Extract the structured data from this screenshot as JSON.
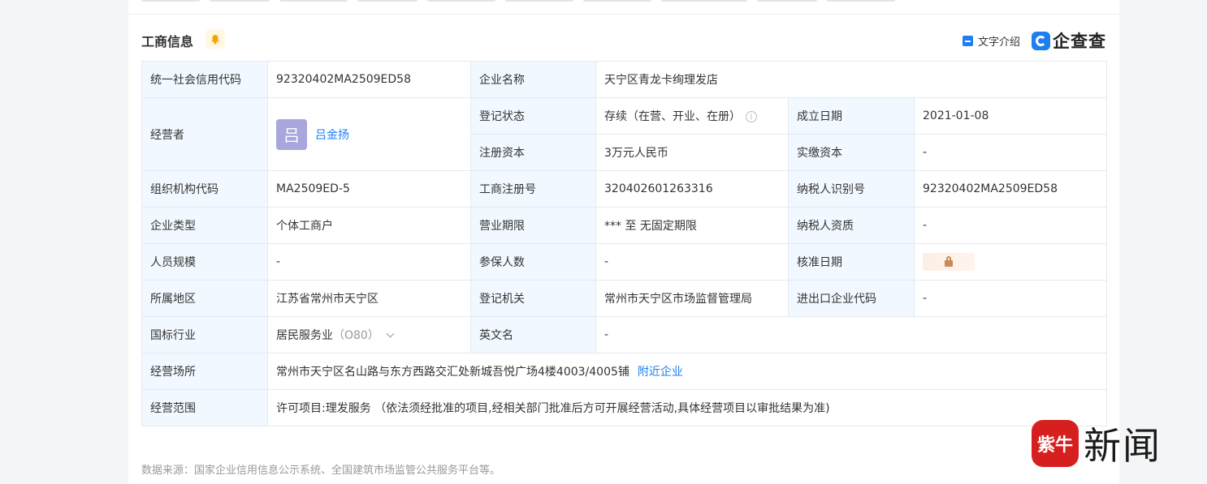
{
  "header": {
    "title": "工商信息",
    "text_intro_label": "文字介绍",
    "brand": "企查查"
  },
  "rows": {
    "credit_code_label": "统一社会信用代码",
    "credit_code": "92320402MA2509ED58",
    "company_name_label": "企业名称",
    "company_name": "天宁区青龙卡绚理发店",
    "operator_label": "经营者",
    "operator_avatar": "吕",
    "operator_name": "吕金扬",
    "reg_status_label": "登记状态",
    "reg_status": "存续（在营、开业、在册）",
    "founded_label": "成立日期",
    "founded": "2021-01-08",
    "reg_capital_label": "注册资本",
    "reg_capital": "3万元人民币",
    "paid_capital_label": "实缴资本",
    "paid_capital": "-",
    "org_code_label": "组织机构代码",
    "org_code": "MA2509ED-5",
    "biz_reg_no_label": "工商注册号",
    "biz_reg_no": "320402601263316",
    "taxpayer_id_label": "纳税人识别号",
    "taxpayer_id": "92320402MA2509ED58",
    "company_type_label": "企业类型",
    "company_type": "个体工商户",
    "biz_term_label": "营业期限",
    "biz_term": "*** 至 无固定期限",
    "taxpayer_qual_label": "纳税人资质",
    "taxpayer_qual": "-",
    "staff_size_label": "人员规模",
    "staff_size": "-",
    "insured_label": "参保人数",
    "insured": "-",
    "approved_date_label": "核准日期",
    "region_label": "所属地区",
    "region": "江苏省常州市天宁区",
    "reg_authority_label": "登记机关",
    "reg_authority": "常州市天宁区市场监督管理局",
    "import_export_label": "进出口企业代码",
    "import_export": "-",
    "industry_label": "国标行业",
    "industry": "居民服务业",
    "industry_code": "（O80）",
    "english_name_label": "英文名",
    "english_name": "-",
    "address_label": "经营场所",
    "address": "常州市天宁区名山路与东方西路交汇处新城吾悦广场4楼4003/4005铺",
    "nearby_link": "附近企业",
    "scope_label": "经营范围",
    "scope": "许可项目:理发服务 （依法须经批准的项目,经相关部门批准后方可开展经营活动,具体经营项目以审批结果为准)"
  },
  "footer": {
    "source": "数据来源：国家企业信用信息公示系统、全国建筑市场监管公共服务平台等。"
  },
  "watermark": {
    "logo_text": "紫牛",
    "text": "新闻"
  }
}
